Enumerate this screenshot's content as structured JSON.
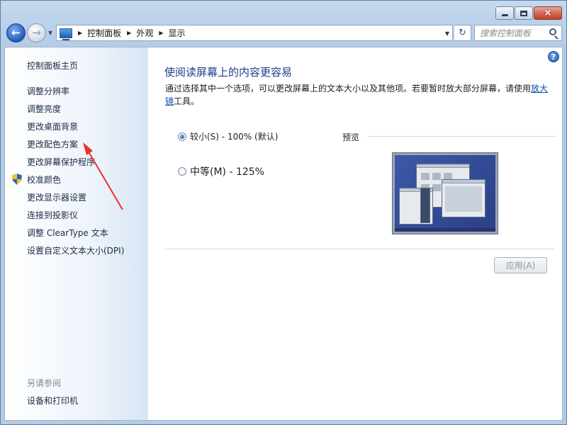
{
  "window": {
    "minimize_label": "minimize",
    "maximize_label": "maximize",
    "close_label": "×"
  },
  "address": {
    "crumbs": [
      "控制面板",
      "外观",
      "显示"
    ]
  },
  "search": {
    "placeholder": "搜索控制面板"
  },
  "sidebar": {
    "home": "控制面板主页",
    "items": [
      "调整分辨率",
      "调整亮度",
      "更改桌面背景",
      "更改配色方案",
      "更改屏幕保护程序",
      "校准颜色",
      "更改显示器设置",
      "连接到投影仪",
      "调整 ClearType 文本",
      "设置自定义文本大小(DPI)"
    ],
    "see_also_title": "另请参阅",
    "see_also_items": [
      "设备和打印机"
    ]
  },
  "main": {
    "title": "使阅读屏幕上的内容更容易",
    "description_before_link": "通过选择其中一个选项，可以更改屏幕上的文本大小以及其他项。若要暂时放大部分屏幕，请使用",
    "description_link": "放大镜",
    "description_after_link": "工具。",
    "options": [
      {
        "label": "较小(S) - 100% (默认)",
        "selected": true
      },
      {
        "label": "中等(M) - 125%",
        "selected": false
      }
    ],
    "preview_label": "预览",
    "apply_label": "应用(A)"
  },
  "help_icon_glyph": "?",
  "colors": {
    "title_blue": "#1e3d8a",
    "link_blue": "#0f4bb0",
    "annotation_arrow": "#e8322b"
  }
}
